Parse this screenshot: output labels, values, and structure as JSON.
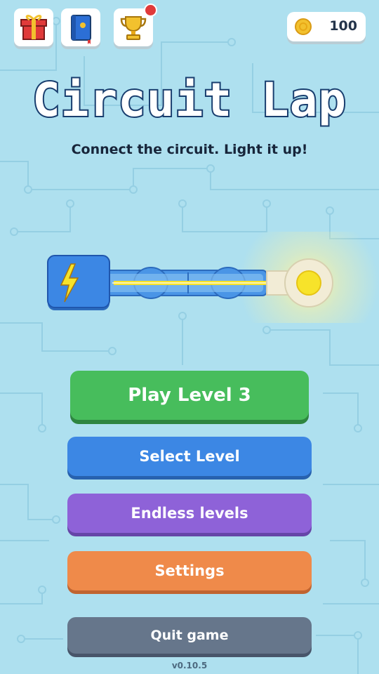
{
  "top_bar": {
    "icons": [
      "gift-icon",
      "journal-icon",
      "trophy-icon"
    ],
    "trophy_has_notification": true,
    "coins": "100"
  },
  "title": "Circuit Lap",
  "subtitle": "Connect the circuit. Light it up!",
  "buttons": {
    "play": "Play Level 3",
    "select": "Select Level",
    "endless": "Endless levels",
    "settings": "Settings",
    "quit": "Quit game"
  },
  "version": "v0.10.5",
  "colors": {
    "background": "#aee0ef",
    "play": "#47bd5c",
    "select": "#3c87e4",
    "endless": "#8e62d8",
    "settings": "#ef8a4a",
    "quit": "#66768b",
    "wire": "#f7e32a",
    "battery": "#3c87e4",
    "bulb": "#f7e32a"
  }
}
